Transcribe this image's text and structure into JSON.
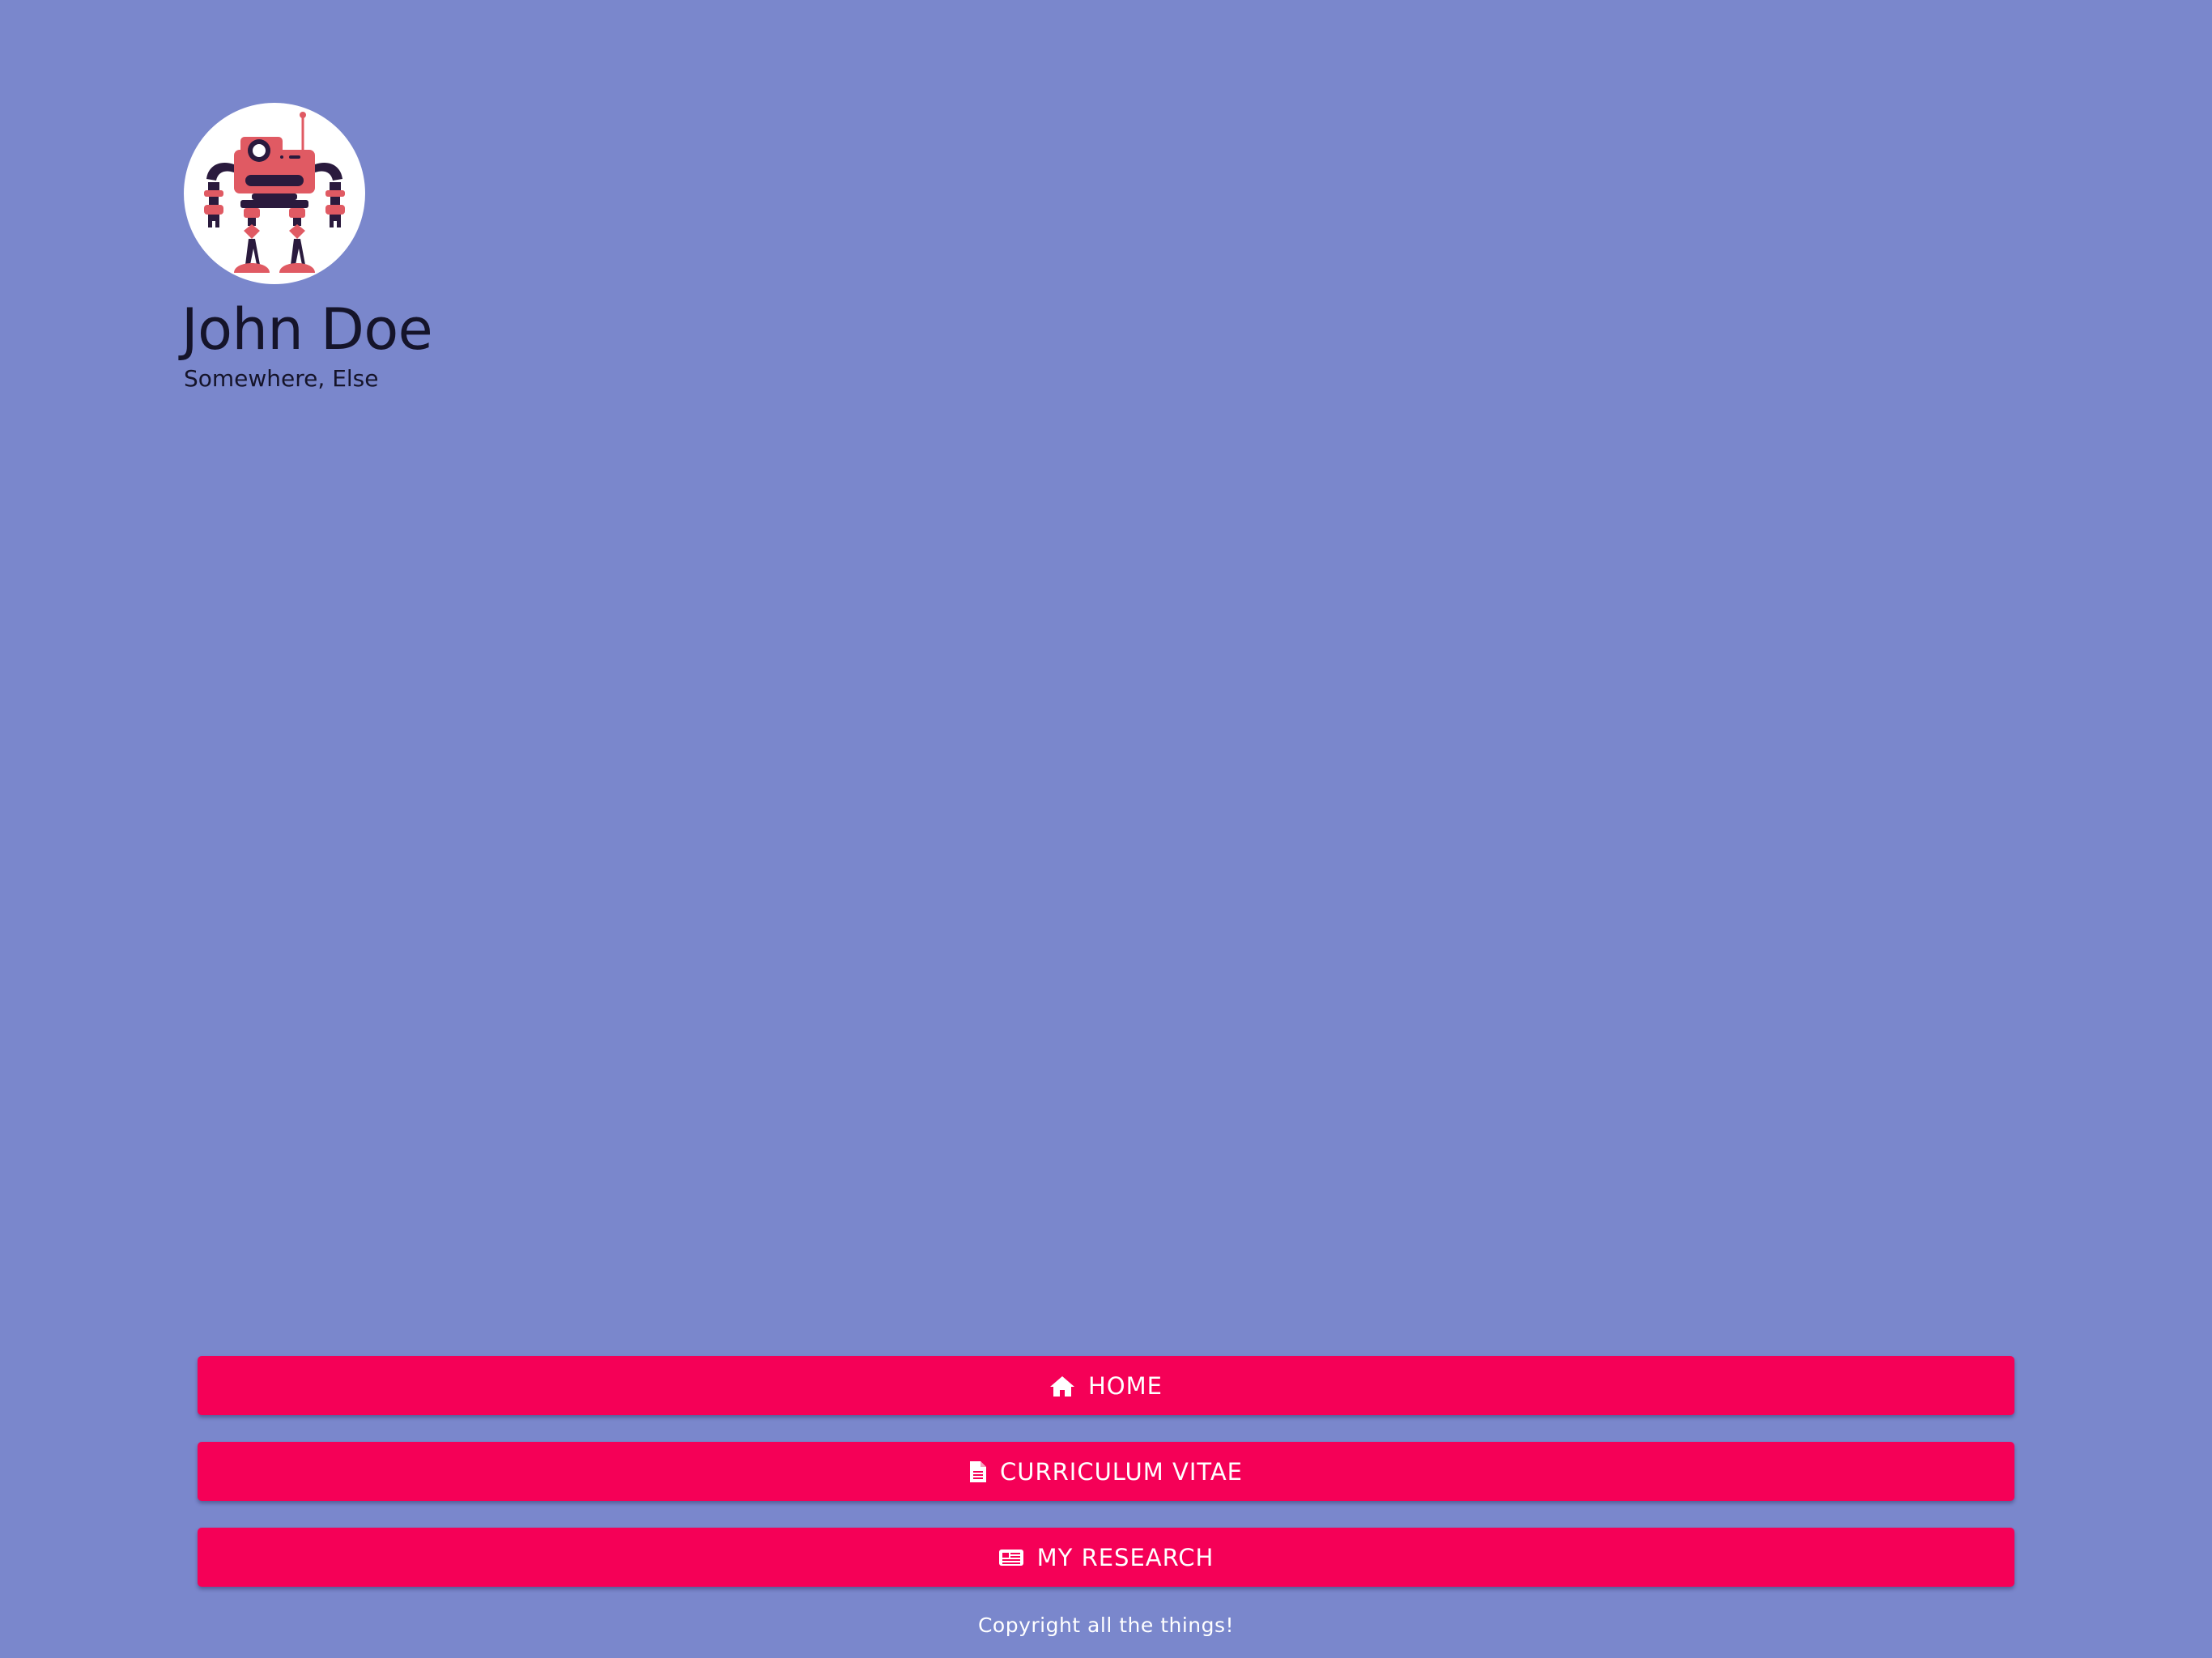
{
  "profile": {
    "name": "John Doe",
    "location": "Somewhere, Else",
    "avatar_icon": "robot-icon"
  },
  "nav": {
    "items": [
      {
        "label": "HOME",
        "icon": "home-icon"
      },
      {
        "label": "CURRICULUM VITAE",
        "icon": "document-icon"
      },
      {
        "label": "MY RESEARCH",
        "icon": "newspaper-icon"
      }
    ]
  },
  "footer": {
    "text": "Copyright all the things!"
  },
  "colors": {
    "background": "#7a87cc",
    "button": "#f50057",
    "button_text": "#ffffff",
    "heading_text": "#15142a",
    "robot_body": "#e05a63",
    "robot_dark": "#2a1a3d"
  }
}
